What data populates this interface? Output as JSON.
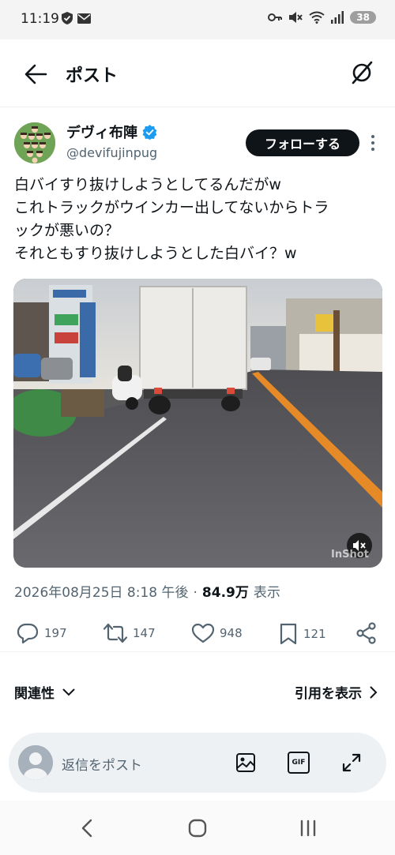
{
  "status_bar": {
    "time": "11:19",
    "battery": "38",
    "left_icons": [
      "shield-check-icon",
      "mail-icon"
    ],
    "right_icons": [
      "key-icon",
      "mute-icon",
      "wifi-icon",
      "signal-icon"
    ]
  },
  "header": {
    "title": "ポスト",
    "back_icon": "arrow-left-icon",
    "grok_icon": "grok-icon"
  },
  "author": {
    "name": "デヴィ布陣",
    "handle": "@devifujinpug",
    "verified": true,
    "follow_label": "フォローする"
  },
  "tweet": {
    "lines": [
      "白バイすり抜けしようとしてるんだがw",
      "これトラックがウインカー出してないからトラ",
      "ックが悪いの？",
      "それともすり抜けしようとした白バイ？w"
    ]
  },
  "media": {
    "watermark": "InShot",
    "mute_icon": "volume-mute-icon"
  },
  "meta": {
    "datetime": "2026年08月25日 8:18 午後",
    "separator": "·",
    "views": "84.9万",
    "views_label": "表示"
  },
  "actions": {
    "replies": "197",
    "reposts": "147",
    "likes": "948",
    "bookmarks": "121"
  },
  "sections": {
    "related_label": "関連性",
    "quotes_label": "引用を表示"
  },
  "reply_bar": {
    "placeholder": "返信をポスト",
    "gif_label": "GIF"
  },
  "colors": {
    "accent_verified": "#1d9bf0",
    "text_primary": "#0f1419",
    "text_secondary": "#536471",
    "follow_bg": "#0f1419"
  }
}
